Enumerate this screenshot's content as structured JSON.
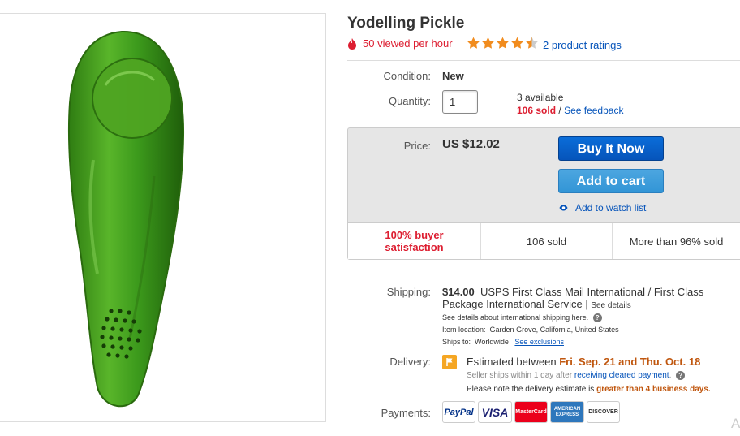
{
  "product": {
    "title": "Yodelling Pickle",
    "views": "50 viewed per hour",
    "ratings_link": "2 product ratings",
    "rating_stars": 4.5
  },
  "condition": {
    "label": "Condition:",
    "value": "New"
  },
  "quantity": {
    "label": "Quantity:",
    "value": "1",
    "available": "3 available",
    "sold": "106 sold",
    "separator": "/",
    "feedback_link": "See feedback"
  },
  "price": {
    "label": "Price:",
    "value": "US $12.02",
    "buy_now": "Buy It Now",
    "add_to_cart": "Add to cart",
    "watch": "Add to watch list"
  },
  "stats": {
    "satisfaction_line1": "100% buyer",
    "satisfaction_line2": "satisfaction",
    "sold": "106 sold",
    "more_than": "More than 96% sold"
  },
  "shipping": {
    "label": "Shipping:",
    "cost": "$14.00",
    "service": "USPS First Class Mail International / First Class Package International Service |",
    "see_details": "See details",
    "intl_details": "See details about international shipping here.",
    "location_label": "Item location:",
    "location": "Garden Grove, California, United States",
    "ships_to_label": "Ships to:",
    "ships_to": "Worldwide",
    "see_exclusions": "See exclusions"
  },
  "delivery": {
    "label": "Delivery:",
    "estimated_prefix": "Estimated between",
    "date_range": "Fri. Sep. 21 and Thu. Oct. 18",
    "seller_ships": "Seller ships within 1 day after",
    "receiving_link": "receiving cleared payment",
    "seller_ships_end": ".",
    "note_prefix": "Please note the delivery estimate is",
    "note_emphasis": "greater than 4 business days."
  },
  "payments": {
    "label": "Payments:",
    "methods": [
      "PayPal",
      "VISA",
      "MasterCard",
      "AMERICAN EXPRESS",
      "DISCOVER"
    ]
  },
  "colors": {
    "link": "#0654ba",
    "alert_red": "#dd1e31",
    "buy_button": "#0654ba",
    "cart_button": "#3295d6",
    "star": "#f18c1e",
    "date_orange": "#c0570f"
  },
  "corner_glyph": "A"
}
